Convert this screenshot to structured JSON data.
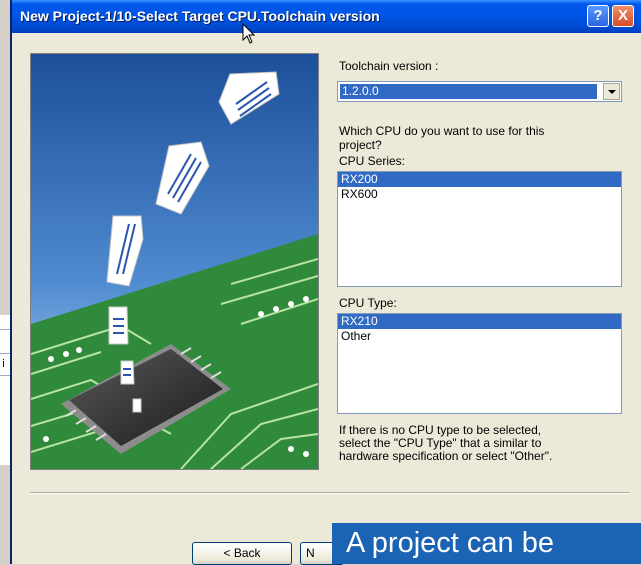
{
  "background_window": {
    "fragment_text": "i"
  },
  "dialog": {
    "title": "New Project-1/10-Select Target CPU.Toolchain version",
    "help_button": "?",
    "close_button": "X"
  },
  "toolchain": {
    "label": "Toolchain version :",
    "selected": "1.2.0.0"
  },
  "question": {
    "line1": "Which CPU do you want to use for this",
    "line2": "project?"
  },
  "cpu_series": {
    "label": "CPU Series:",
    "items": [
      "RX200",
      "RX600"
    ],
    "selected_index": 0
  },
  "cpu_type": {
    "label": "CPU Type:",
    "items": [
      "RX210",
      "Other"
    ],
    "selected_index": 0
  },
  "note": {
    "line1": "If there is no CPU type to be selected,",
    "line2": "select the \"CPU Type\" that a similar to",
    "line3": "hardware specification or select \"Other\"."
  },
  "buttons": {
    "back": "< Back",
    "next_partial": "N"
  },
  "caption": {
    "text": "A project can be"
  },
  "colors": {
    "selection": "#316ac5",
    "titlebar": "#0055e5",
    "caption_bg": "#1b63b4",
    "pcb_green": "#2f8a3c",
    "sky_blue": "#1d4f9a"
  },
  "icons": [
    "cursor-arrow-icon",
    "help-icon",
    "close-icon",
    "dropdown-arrow-icon"
  ]
}
